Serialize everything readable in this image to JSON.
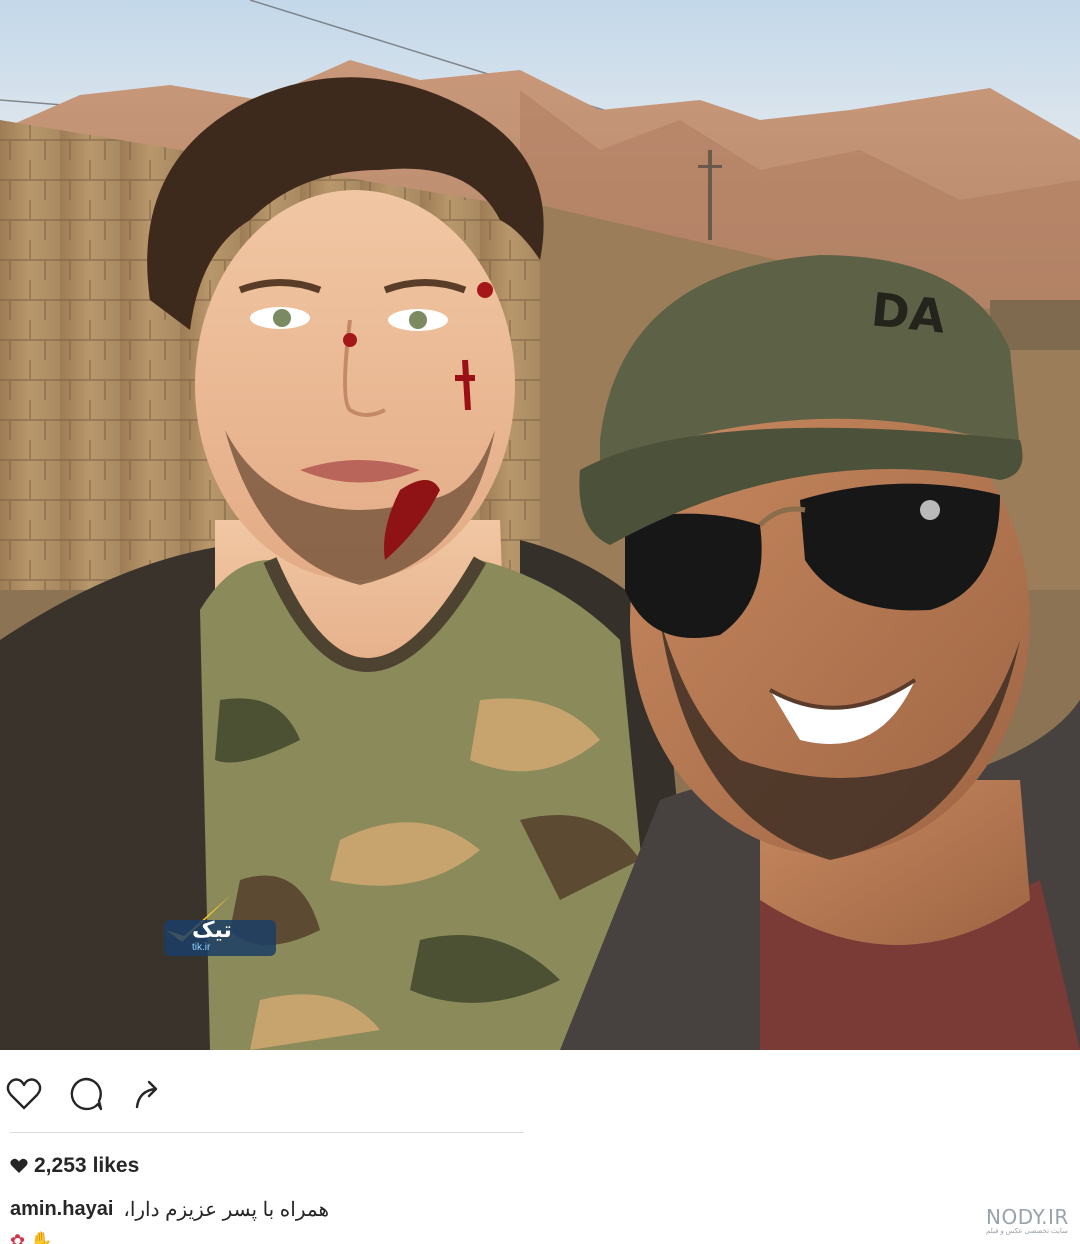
{
  "post": {
    "likes_count": "2,253",
    "likes_label": "likes",
    "username": "amin.hayai",
    "caption": "همراه با پسر عزیزم دارا،",
    "caption_line2": "... ... ...",
    "photo_alt": "selfie"
  },
  "actions": {
    "like_icon": "heart-outline-icon",
    "comment_icon": "comment-bubble-icon",
    "share_icon": "share-arrow-icon"
  },
  "overlay_logo": {
    "text": "تیک",
    "sub": "tik.ir"
  },
  "watermark": {
    "brand": "NODY.IR",
    "sub": "سایت تخصصی عکس و فیلم"
  },
  "colors": {
    "text": "#262626",
    "divider": "#dbdbdb",
    "sky": "#c9dcec",
    "mountain": "#c99a78",
    "wall": "#a98a63",
    "cap": "#5d6246",
    "camo_light": "#c7a46d",
    "camo_dark": "#4b5132",
    "shirt": "#7a3a36"
  }
}
